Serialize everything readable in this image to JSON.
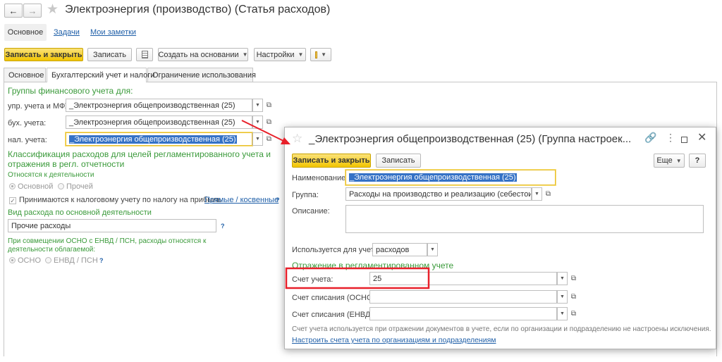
{
  "main": {
    "title": "Электроэнергия (производство) (Статья расходов)",
    "nav": [
      {
        "label": "Основное"
      },
      {
        "label": "Задачи"
      },
      {
        "label": "Мои заметки"
      }
    ],
    "toolbar": {
      "save_close": "Записать и закрыть",
      "save": "Записать",
      "create_based": "Создать на основании",
      "settings": "Настройки"
    },
    "tabs": [
      {
        "label": "Основное"
      },
      {
        "label": "Бухгалтерский учет и налоги"
      },
      {
        "label": "Ограничение использования"
      }
    ],
    "groups_heading": "Группы финансового учета для:",
    "upr_label": "упр. учета и МФУ:",
    "upr_value": "_Электроэнергия общепроизводственная (25)",
    "buh_label": "бух. учета:",
    "buh_value": "_Электроэнергия общепроизводственная (25)",
    "nal_label": "нал. учета:",
    "nal_value": "_Электроэнергия общепроизводственная (25)",
    "class_heading_line1": "Классификация расходов для целей регламентированного учета и",
    "class_heading_line2": "отражения в регл. отчетности",
    "activity_label": "Относятся к деятельности",
    "activity_main": "Основной",
    "activity_other": "Прочей",
    "accepted_label": "Принимаются к налоговому учету по налогу на прибыль",
    "direct_indirect_link": "Прямые / косвенные",
    "question_mark": "?",
    "expense_type_label": "Вид расхода по основной деятельности",
    "expense_type_value": "Прочие расходы",
    "combo_line1": "При совмещении ОСНО с ЕНВД / ПСН, расходы относятся к",
    "combo_line2": "деятельности облагаемой:",
    "osno": "ОСНО",
    "envd": "ЕНВД / ПСН"
  },
  "popup": {
    "title": "_Электроэнергия общепроизводственная (25) (Группа настроек...",
    "save_close": "Записать и закрыть",
    "save": "Записать",
    "more": "Еще",
    "help": "?",
    "name_label": "Наименование:",
    "name_value": "_Электроэнергия общепроизводственная (25)",
    "group_label": "Группа:",
    "group_value": "Расходы на производство и реализацию (себестоимость",
    "description_label": "Описание:",
    "used_for_label": "Используется для учета:",
    "used_for_value": "расходов",
    "reflection_heading": "Отражение в регламентированном учете",
    "account_label": "Счет учета:",
    "account_value": "25",
    "writeoff_osno_label": "Счет списания (ОСНО):",
    "writeoff_envd_label": "Счет списания (ЕНВД):",
    "note": "Счет учета используется при отражении документов в учете, если по организации и подразделению не настроены исключения.",
    "configure_link": "Настроить счета учета по организациям и подразделениям"
  },
  "colors": {
    "accent_yellow": "#f2c500",
    "green_text": "#3a9a3a",
    "link_blue": "#1f5fa8",
    "annotation_red": "#e8202a"
  }
}
